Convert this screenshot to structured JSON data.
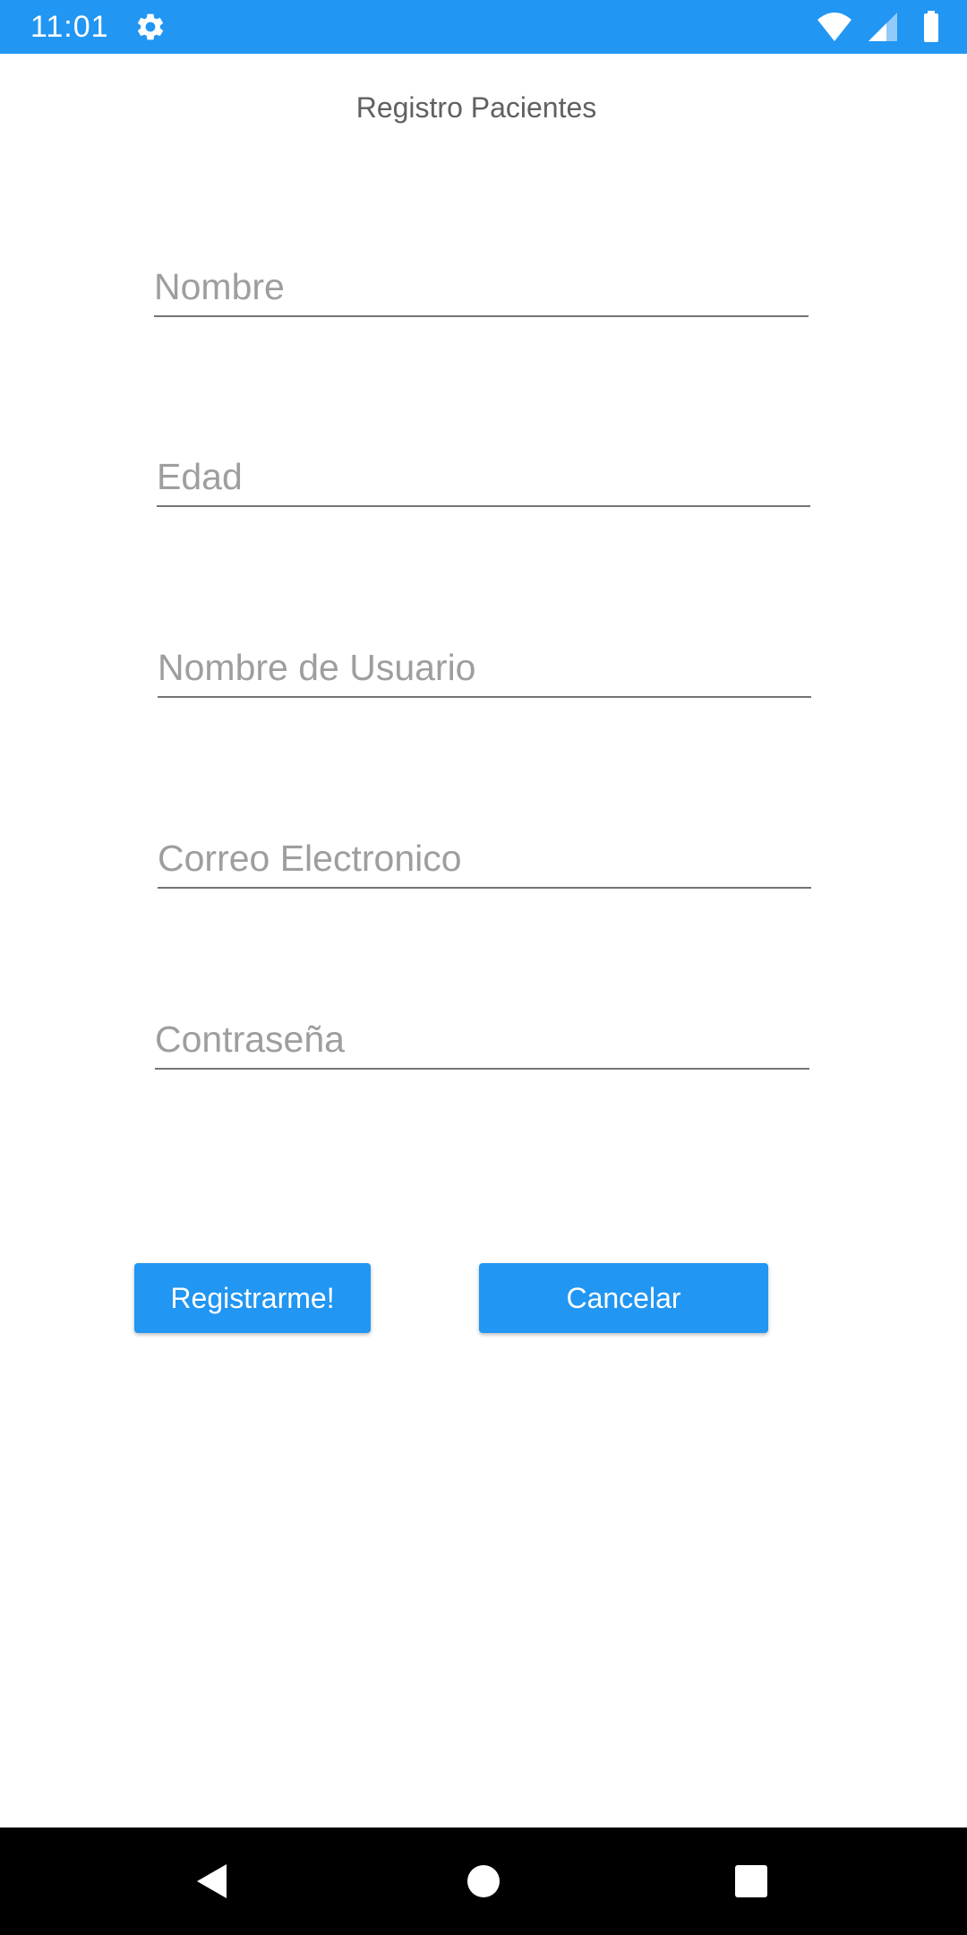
{
  "status_bar": {
    "time": "11:01",
    "icons": [
      "gear-icon",
      "wifi-icon",
      "signal-icon",
      "battery-icon"
    ],
    "background_color": "#2196F3"
  },
  "form": {
    "title": "Registro Pacientes",
    "fields": [
      {
        "placeholder": "Nombre",
        "value": ""
      },
      {
        "placeholder": "Edad",
        "value": ""
      },
      {
        "placeholder": "Nombre de Usuario",
        "value": ""
      },
      {
        "placeholder": "Correo Electronico",
        "value": ""
      },
      {
        "placeholder": "Contraseña",
        "value": ""
      }
    ],
    "register_label": "Registrarme!",
    "cancel_label": "Cancelar",
    "button_color": "#2196F3"
  },
  "nav_bar": {
    "icons": [
      "back-icon",
      "home-icon",
      "recents-icon"
    ]
  }
}
